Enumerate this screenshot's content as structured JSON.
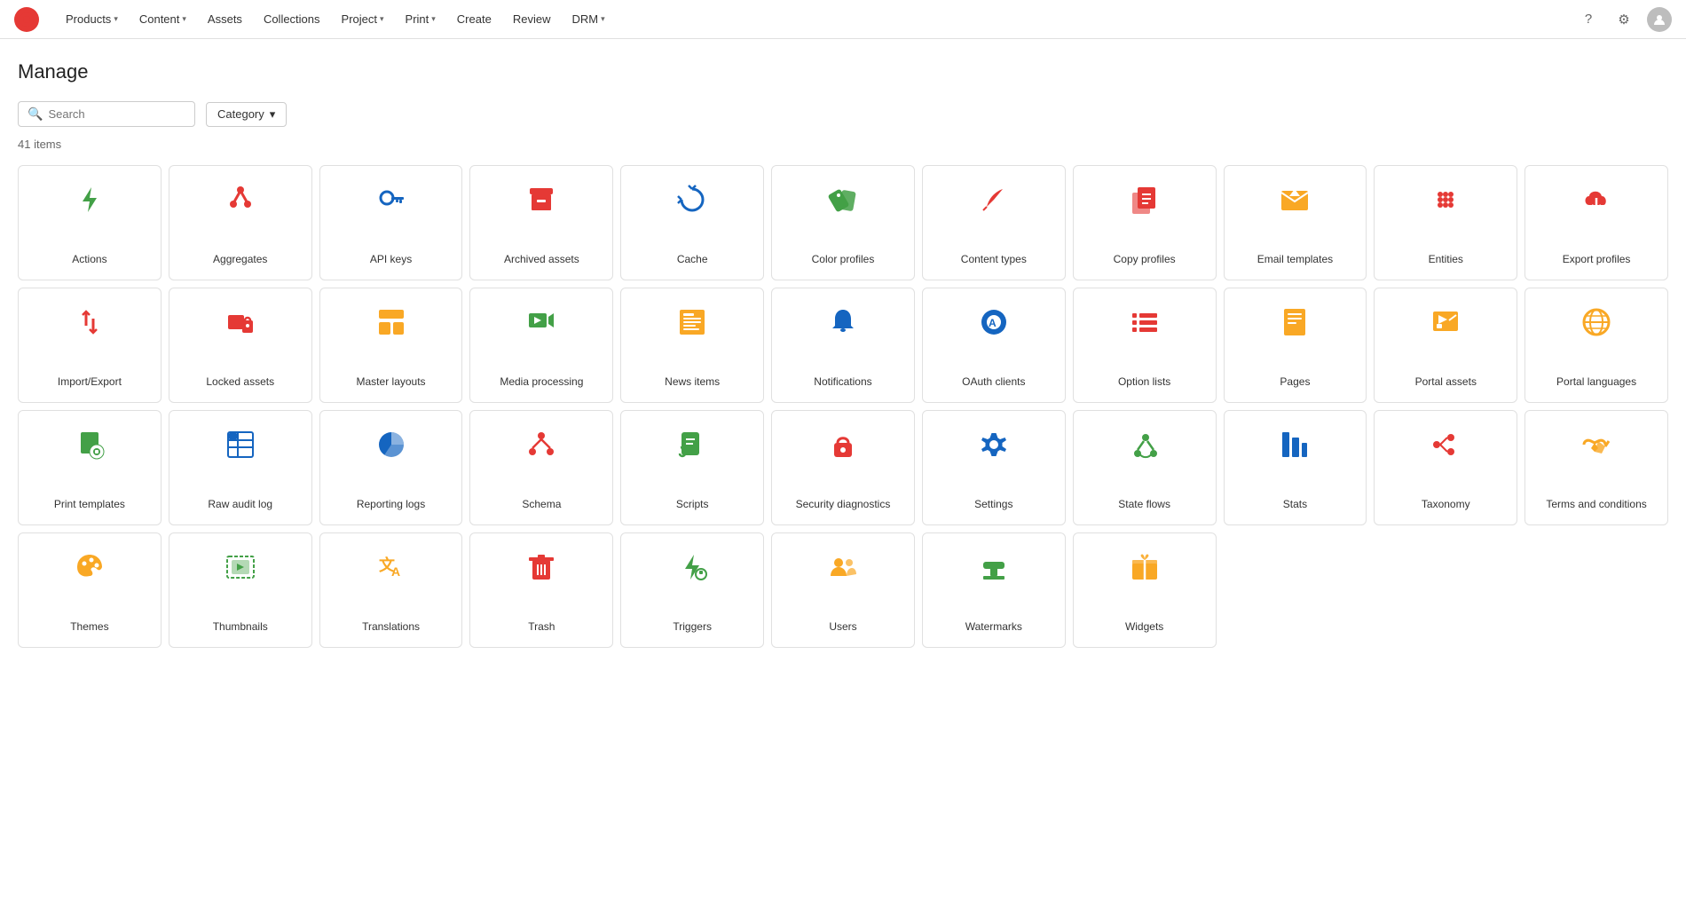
{
  "navbar": {
    "logo_label": "App Logo",
    "nav_items": [
      {
        "label": "Products",
        "has_arrow": true
      },
      {
        "label": "Content",
        "has_arrow": true
      },
      {
        "label": "Assets",
        "has_arrow": false
      },
      {
        "label": "Collections",
        "has_arrow": false
      },
      {
        "label": "Project",
        "has_arrow": true
      },
      {
        "label": "Print",
        "has_arrow": true
      },
      {
        "label": "Create",
        "has_arrow": false
      },
      {
        "label": "Review",
        "has_arrow": false
      },
      {
        "label": "DRM",
        "has_arrow": true
      }
    ]
  },
  "page": {
    "title": "Manage",
    "search_placeholder": "Search",
    "category_label": "Category",
    "items_count": "41 items"
  },
  "grid_items": [
    {
      "label": "Actions",
      "icon": "bolt",
      "color": "green"
    },
    {
      "label": "Aggregates",
      "icon": "aggregate",
      "color": "red"
    },
    {
      "label": "API keys",
      "icon": "key",
      "color": "blue"
    },
    {
      "label": "Archived assets",
      "icon": "archive",
      "color": "red"
    },
    {
      "label": "Cache",
      "icon": "cache",
      "color": "blue"
    },
    {
      "label": "Color profiles",
      "icon": "tag",
      "color": "green"
    },
    {
      "label": "Content types",
      "icon": "feather",
      "color": "red"
    },
    {
      "label": "Copy profiles",
      "icon": "copy",
      "color": "red"
    },
    {
      "label": "Email templates",
      "icon": "email",
      "color": "yellow"
    },
    {
      "label": "Entities",
      "icon": "grid",
      "color": "red"
    },
    {
      "label": "Export profiles",
      "icon": "cloud-download",
      "color": "red"
    },
    {
      "label": "Import/Export",
      "icon": "import-export",
      "color": "red"
    },
    {
      "label": "Locked assets",
      "icon": "locked-assets",
      "color": "red"
    },
    {
      "label": "Master layouts",
      "icon": "layout",
      "color": "yellow"
    },
    {
      "label": "Media processing",
      "icon": "media",
      "color": "green"
    },
    {
      "label": "News items",
      "icon": "news",
      "color": "yellow"
    },
    {
      "label": "Notifications",
      "icon": "bell",
      "color": "blue"
    },
    {
      "label": "OAuth clients",
      "icon": "oauth",
      "color": "blue"
    },
    {
      "label": "Option lists",
      "icon": "list",
      "color": "red"
    },
    {
      "label": "Pages",
      "icon": "page",
      "color": "yellow"
    },
    {
      "label": "Portal assets",
      "icon": "portal-assets",
      "color": "yellow"
    },
    {
      "label": "Portal languages",
      "icon": "globe",
      "color": "yellow"
    },
    {
      "label": "Print templates",
      "icon": "print-file",
      "color": "green"
    },
    {
      "label": "Raw audit log",
      "icon": "table",
      "color": "blue"
    },
    {
      "label": "Reporting logs",
      "icon": "pie",
      "color": "blue"
    },
    {
      "label": "Schema",
      "icon": "schema",
      "color": "red"
    },
    {
      "label": "Scripts",
      "icon": "script",
      "color": "green"
    },
    {
      "label": "Security diagnostics",
      "icon": "padlock",
      "color": "red"
    },
    {
      "label": "Settings",
      "icon": "settings",
      "color": "blue"
    },
    {
      "label": "State flows",
      "icon": "state",
      "color": "green"
    },
    {
      "label": "Stats",
      "icon": "stats",
      "color": "blue"
    },
    {
      "label": "Taxonomy",
      "icon": "taxonomy",
      "color": "red"
    },
    {
      "label": "Terms and conditions",
      "icon": "handshake",
      "color": "yellow"
    },
    {
      "label": "Themes",
      "icon": "palette",
      "color": "yellow"
    },
    {
      "label": "Thumbnails",
      "icon": "thumbnail",
      "color": "green"
    },
    {
      "label": "Translations",
      "icon": "translate",
      "color": "yellow"
    },
    {
      "label": "Trash",
      "icon": "trash",
      "color": "red"
    },
    {
      "label": "Triggers",
      "icon": "trigger",
      "color": "green"
    },
    {
      "label": "Users",
      "icon": "users",
      "color": "yellow"
    },
    {
      "label": "Watermarks",
      "icon": "stamp",
      "color": "green"
    },
    {
      "label": "Widgets",
      "icon": "gift",
      "color": "yellow"
    }
  ]
}
